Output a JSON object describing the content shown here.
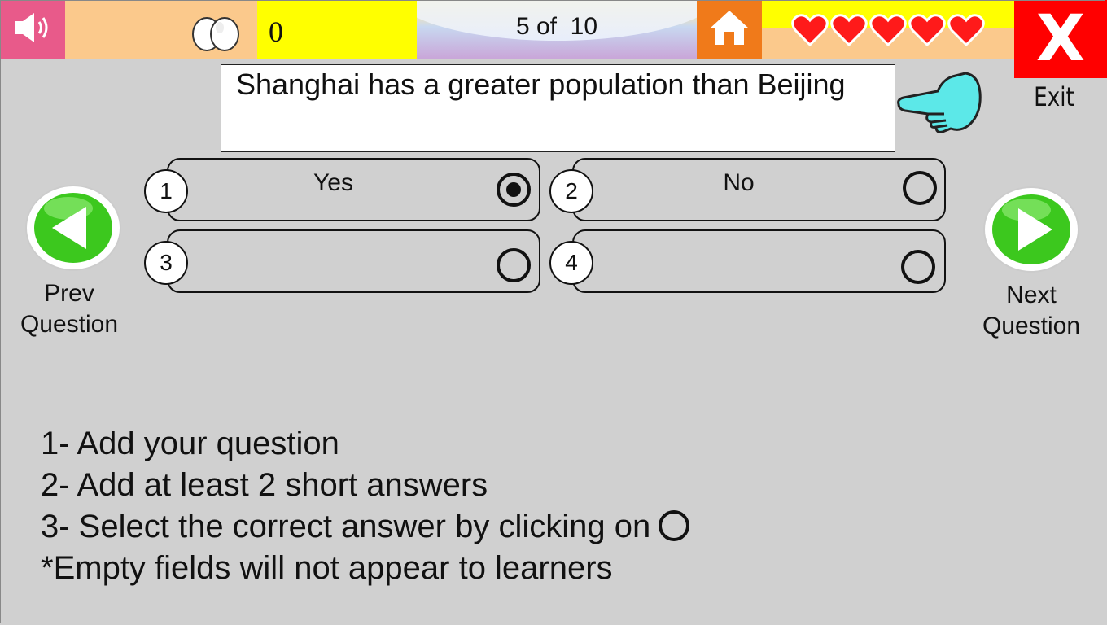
{
  "topbar": {
    "score": "0",
    "progress": "5 of  10",
    "lives": 5,
    "exit_label": "Exit"
  },
  "question": {
    "text": "Shanghai has a greater population than Beijing"
  },
  "answers": [
    {
      "number": "1",
      "label": "Yes",
      "selected": true
    },
    {
      "number": "2",
      "label": "No",
      "selected": false
    },
    {
      "number": "3",
      "label": "",
      "selected": false
    },
    {
      "number": "4",
      "label": "",
      "selected": false
    }
  ],
  "nav": {
    "prev_line1": "Prev",
    "prev_line2": "Question",
    "next_line1": "Next",
    "next_line2": "Question"
  },
  "instructions": {
    "line1": "1- Add your question",
    "line2": "2- Add at least 2 short answers",
    "line3": "3- Select the correct answer by clicking on",
    "line4": "*Empty fields will not appear to learners"
  },
  "colors": {
    "background": "#d0d0d0",
    "sound": "#e85a8a",
    "eggs_panel": "#fbc98c",
    "score_panel": "#ffff00",
    "home": "#f07a1a",
    "exit": "#ff0000",
    "hearts": "#ff1a1a",
    "nav_green": "#3cc81e",
    "pointer_cyan": "#5ce8e8"
  },
  "icons": {
    "sound": "speaker-icon",
    "eggs": "eggs-icon",
    "home": "home-icon",
    "lives": "heart-icon",
    "exit": "close-icon",
    "pointer": "pointing-hand-icon",
    "prev": "arrow-left-icon",
    "next": "arrow-right-icon"
  }
}
